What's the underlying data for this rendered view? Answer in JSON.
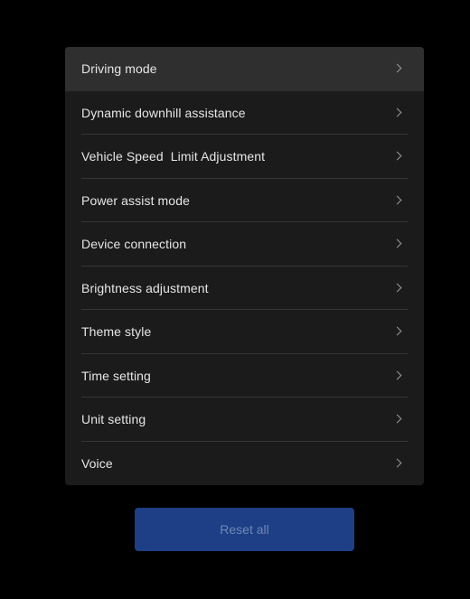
{
  "menu": {
    "items": [
      {
        "label": "Driving mode"
      },
      {
        "label": "Dynamic downhill assistance"
      },
      {
        "label": "Vehicle Speed  Limit Adjustment"
      },
      {
        "label": "Power assist mode"
      },
      {
        "label": "Device connection"
      },
      {
        "label": "Brightness adjustment"
      },
      {
        "label": "Theme style"
      },
      {
        "label": "Time setting"
      },
      {
        "label": "Unit setting"
      },
      {
        "label": "Voice"
      }
    ],
    "active_index": 0,
    "chevron_icon": "chevron-right-icon"
  },
  "reset": {
    "label": "Reset all"
  },
  "colors": {
    "background": "#000000",
    "card": "#1b1b1b",
    "active_row": "#2f2f2f",
    "button": "#1e3f86",
    "button_text": "#6f87b6"
  }
}
